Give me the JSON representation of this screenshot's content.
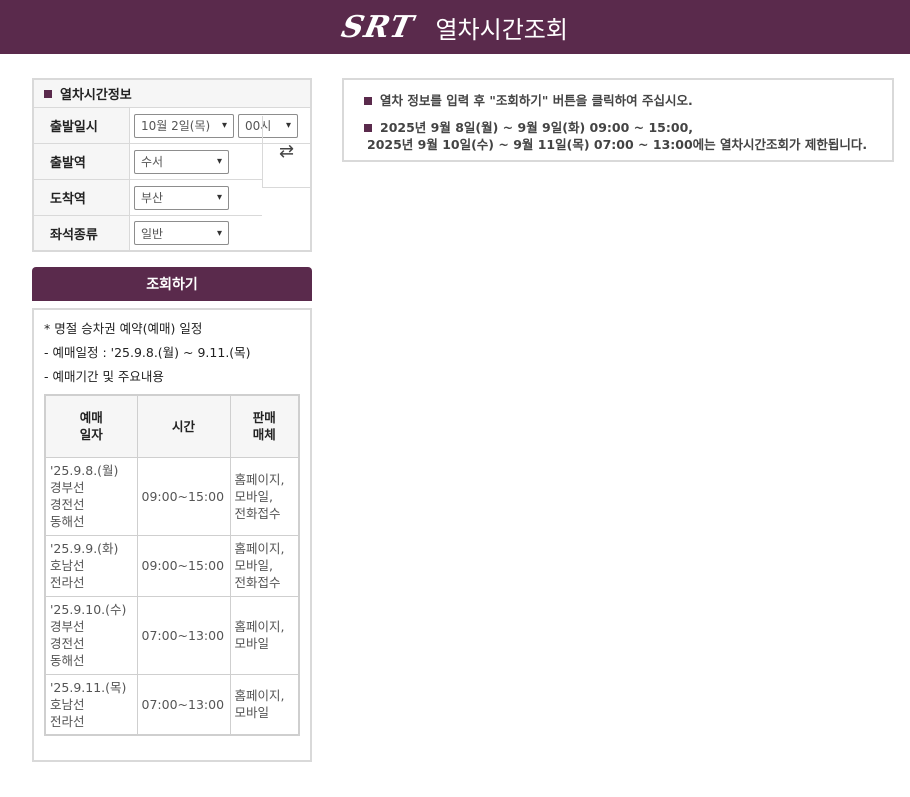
{
  "header": {
    "logo": "SRT",
    "title": "열차시간조회"
  },
  "form": {
    "title": "열차시간정보",
    "departure_date_label": "출발일시",
    "date_value": "10월 2일(목)",
    "hour_value": "00시",
    "departure_station_label": "출발역",
    "departure_station_value": "수서",
    "arrival_station_label": "도착역",
    "arrival_station_value": "부산",
    "seat_type_label": "좌석종류",
    "seat_type_value": "일반",
    "swap_icon": "swap-arrows-icon"
  },
  "search_button": {
    "label": "조회하기"
  },
  "holiday_notice": {
    "title": "* 명절 승차권 예약(예매) 일정",
    "period": "- 예매일정 : '25.9.8.(월) ~ 9.11.(목)",
    "subtitle": "- 예매기간 및 주요내용",
    "headers": [
      "예매\n일자",
      "시간",
      "판매\n매체"
    ],
    "rows": [
      {
        "date": "'25.9.8.(월)\n경부선\n경전선\n동해선",
        "time": "09:00~15:00",
        "media": "홈페이지,\n모바일,\n전화접수"
      },
      {
        "date": "'25.9.9.(화)\n호남선\n전라선",
        "time": "09:00~15:00",
        "media": "홈페이지,\n모바일,\n전화접수"
      },
      {
        "date": "'25.9.10.(수)\n경부선\n경전선\n동해선",
        "time": "07:00~13:00",
        "media": "홈페이지,\n모바일"
      },
      {
        "date": "'25.9.11.(목)\n호남선\n전라선",
        "time": "07:00~13:00",
        "media": "홈페이지,\n모바일"
      }
    ]
  },
  "info": {
    "line1": "열차 정보를 입력 후 \"조회하기\" 버튼을 클릭하여 주십시오.",
    "line2a": "2025년 9월 8일(월) ~ 9월 9일(화) 09:00 ~ 15:00,",
    "line2b": "2025년 9월 10일(수) ~ 9월 11일(목) 07:00 ~ 13:00에는 열차시간조회가 제한됩니다."
  },
  "colors": {
    "brand": "#5a2a4c",
    "border": "#d9d9d9"
  }
}
